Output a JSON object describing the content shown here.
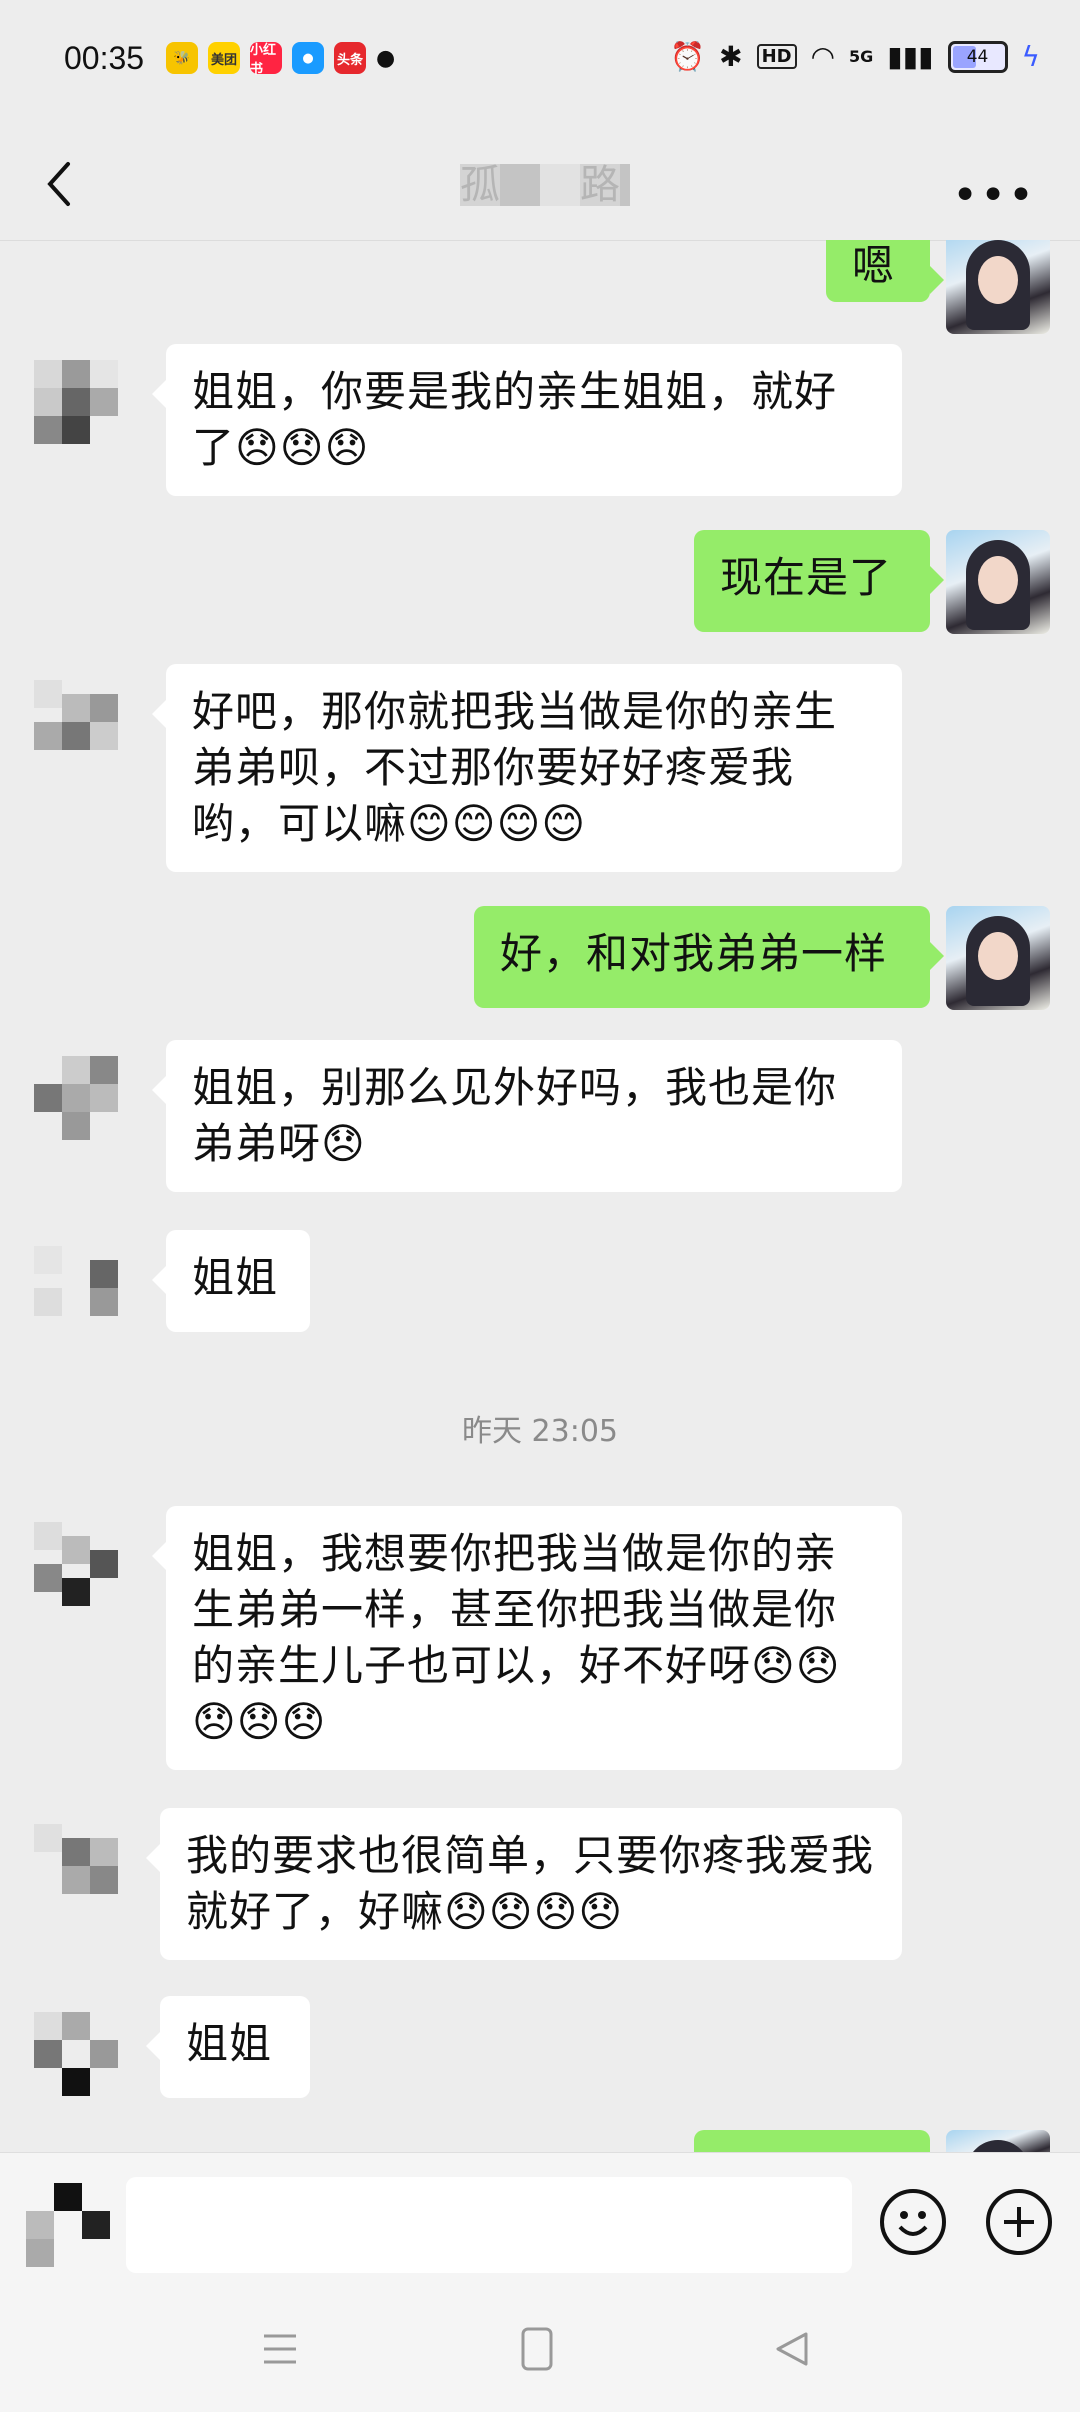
{
  "status_bar": {
    "time": "00:35",
    "app_icons": [
      "美团",
      "小红书",
      "头条"
    ],
    "hd": "HD",
    "network": "5G",
    "battery": "44"
  },
  "header": {
    "title": "孤　　路"
  },
  "messages": [
    {
      "side": "right",
      "text": "嗯",
      "top": 0
    },
    {
      "side": "left",
      "text": "姐姐，你要是我的亲生姐姐，就好了😞😞😞"
    },
    {
      "side": "right",
      "text": "现在是了"
    },
    {
      "side": "left",
      "text": "好吧，那你就把我当做是你的亲生弟弟呗，不过那你要好好疼爱我哟，可以嘛😊😊😊😊"
    },
    {
      "side": "right",
      "text": "好，和对我弟弟一样"
    },
    {
      "side": "left",
      "text": "姐姐，别那么见外好吗，我也是你弟弟呀😞"
    },
    {
      "side": "left",
      "text": "姐姐"
    },
    {
      "side": "left",
      "text": "姐姐，我想要你把我当做是你的亲生弟弟一样，甚至你把我当做是你的亲生儿子也可以，好不好呀😞😞😞😞😞"
    },
    {
      "side": "left",
      "text": "我的要求也很简单，只要你疼我爱我就好了，好嘛😞😞😞😞"
    },
    {
      "side": "left",
      "text": "姐姐"
    }
  ],
  "timestamp": "昨天 23:05",
  "input": {
    "placeholder": ""
  },
  "icons": {
    "back": "chevron-left-icon",
    "more": "more-horizontal-icon",
    "emoji": "smile-icon",
    "plus": "plus-icon"
  }
}
